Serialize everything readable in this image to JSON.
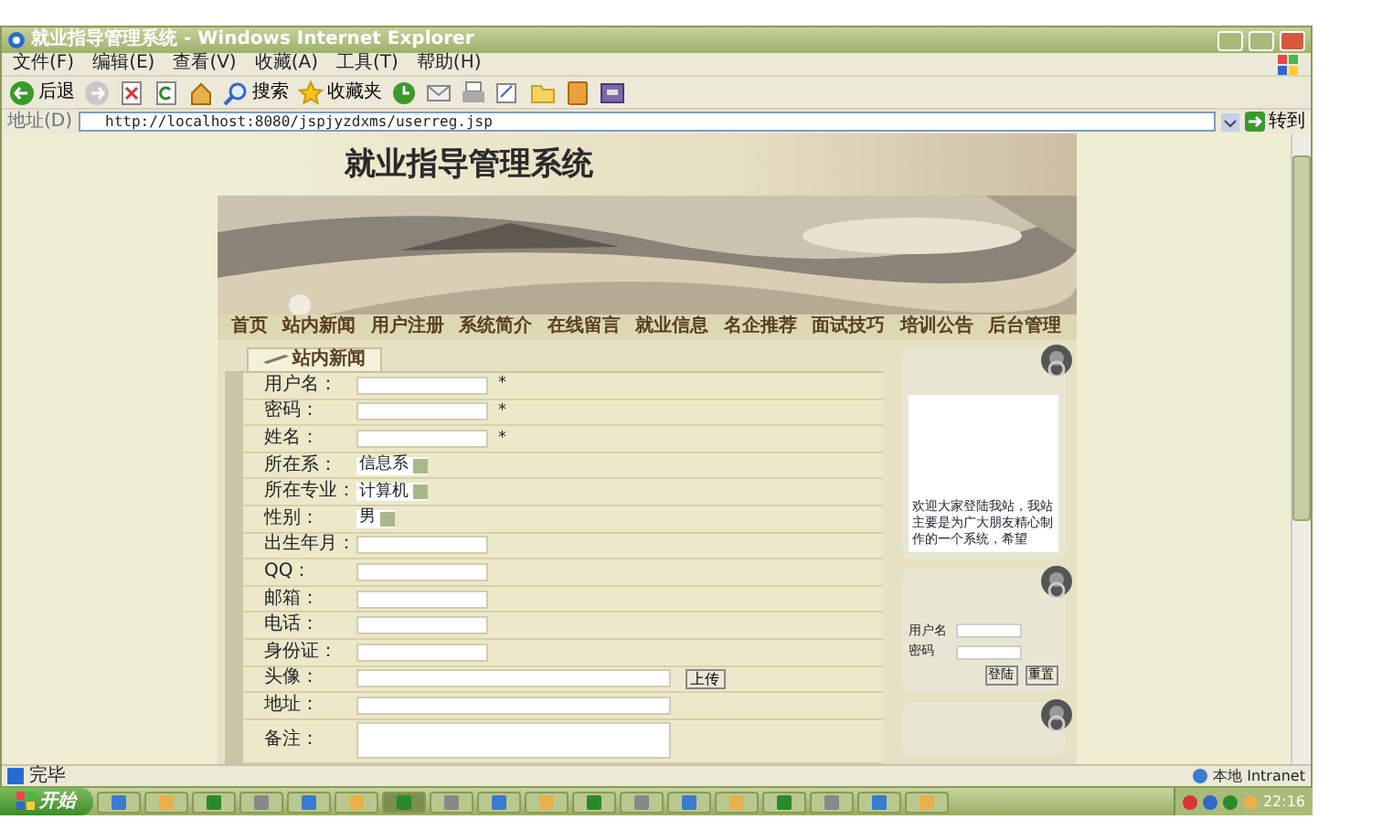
{
  "window": {
    "title": "就业指导管理系统 - Windows Internet Explorer"
  },
  "menu": [
    "文件(F)",
    "编辑(E)",
    "查看(V)",
    "收藏(A)",
    "工具(T)",
    "帮助(H)"
  ],
  "toolbar": [
    {
      "kind": "back",
      "label": "后退"
    },
    {
      "kind": "forward"
    },
    {
      "kind": "stop"
    },
    {
      "kind": "refresh"
    },
    {
      "kind": "home"
    },
    {
      "kind": "search",
      "label": "搜索"
    },
    {
      "kind": "favorites",
      "label": "收藏夹"
    },
    {
      "kind": "history"
    },
    {
      "kind": "mail"
    },
    {
      "kind": "print"
    },
    {
      "kind": "edit"
    },
    {
      "kind": "folder"
    },
    {
      "kind": "book"
    },
    {
      "kind": "archive"
    }
  ],
  "address": {
    "label": "地址(D)",
    "url": "http://localhost:8080/jspjyzdxms/userreg.jsp",
    "go": "转到"
  },
  "page": {
    "site_title": "就业指导管理系统",
    "nav": [
      "首页",
      "站内新闻",
      "用户注册",
      "系统简介",
      "在线留言",
      "就业信息",
      "名企推荐",
      "面试技巧",
      "培训公告",
      "后台管理"
    ],
    "tab": "站内新闻",
    "fields": [
      {
        "label": "用户名：",
        "kind": "text",
        "required": true
      },
      {
        "label": "密码：",
        "kind": "text",
        "required": true
      },
      {
        "label": "姓名：",
        "kind": "text",
        "required": true
      },
      {
        "label": "所在系：",
        "kind": "select",
        "value": "信息系"
      },
      {
        "label": "所在专业：",
        "kind": "select",
        "value": "计算机"
      },
      {
        "label": "性别：",
        "kind": "select",
        "value": "男"
      },
      {
        "label": "出生年月：",
        "kind": "text"
      },
      {
        "label": "QQ：",
        "kind": "text"
      },
      {
        "label": "邮箱：",
        "kind": "text"
      },
      {
        "label": "电话：",
        "kind": "text"
      },
      {
        "label": "身份证：",
        "kind": "text"
      },
      {
        "label": "头像：",
        "kind": "file",
        "button": "上传"
      },
      {
        "label": "地址：",
        "kind": "wide"
      },
      {
        "label": "备注：",
        "kind": "textarea"
      }
    ],
    "required_mark": "*",
    "welcome": "欢迎大家登陆我站，我站主要是为广大朋友精心制作的一个系统，希望",
    "login": {
      "fields": [
        "用户名",
        "密码"
      ],
      "buttons": [
        "登陆",
        "重置"
      ]
    }
  },
  "status_bar": {
    "text": "完毕",
    "zone": "本地 Intranet"
  },
  "taskbar": {
    "start": "开始",
    "buttons": [
      {
        "selected": false
      },
      {
        "selected": false
      },
      {
        "selected": false
      },
      {
        "selected": false
      },
      {
        "selected": false
      },
      {
        "selected": false
      },
      {
        "selected": true
      },
      {
        "selected": false
      },
      {
        "selected": false
      },
      {
        "selected": false
      },
      {
        "selected": false
      },
      {
        "selected": false
      },
      {
        "selected": false
      },
      {
        "selected": false
      },
      {
        "selected": false
      },
      {
        "selected": false
      },
      {
        "selected": false
      },
      {
        "selected": false
      }
    ],
    "clock": "22:16"
  }
}
